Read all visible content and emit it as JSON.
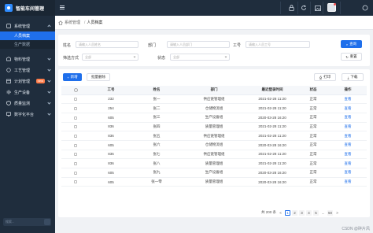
{
  "app": {
    "title": "智能车间管理"
  },
  "sidebar": {
    "items": [
      {
        "label": "系统管理",
        "icon": "system-icon",
        "expanded": true,
        "children": [
          {
            "label": "人员档案",
            "active": true
          },
          {
            "label": "生产数据",
            "active": false
          }
        ]
      },
      {
        "label": "物料管理",
        "icon": "material-icon"
      },
      {
        "label": "工艺管理",
        "icon": "process-icon"
      },
      {
        "label": "计划管理",
        "icon": "plan-icon",
        "badge": "new"
      },
      {
        "label": "生产设备",
        "icon": "equipment-icon"
      },
      {
        "label": "质量监测",
        "icon": "quality-icon"
      },
      {
        "label": "数字化平台",
        "icon": "digital-icon"
      }
    ],
    "search_placeholder": "搜索..."
  },
  "topbar": {
    "icons": [
      "menu-icon",
      "lock-icon",
      "refresh-icon",
      "image-icon",
      "bell-icon",
      "avatar"
    ]
  },
  "breadcrumb": {
    "items": [
      "系统管理",
      "人员档案"
    ]
  },
  "filters": {
    "name_label": "姓名",
    "name_placeholder": "请输入人员姓名",
    "dept_label": "部门",
    "dept_placeholder": "请输入人员部门",
    "id_label": "工号",
    "id_placeholder": "请输入人员工号",
    "sort_label": "筛选方式",
    "sort_value": "全部",
    "status_label": "状态",
    "status_value": "全部",
    "search_btn": "查询",
    "reset_btn": "重置"
  },
  "toolbar": {
    "add_btn": "新增",
    "batch_delete_btn": "批量删除",
    "print_btn": "打印",
    "download_btn": "下载"
  },
  "table": {
    "columns": [
      "工号",
      "姓名",
      "部门",
      "最近登录时间",
      "状态",
      "操作"
    ],
    "rows": [
      {
        "id": "232",
        "name": "张一",
        "dept": "供应链管理组",
        "time": "2021-02-28 11:20",
        "status": "正常",
        "op": "查看"
      },
      {
        "id": "254",
        "name": "张二",
        "dept": "仓储物流组",
        "time": "2021-02-28 11:20",
        "status": "正常",
        "op": "查看"
      },
      {
        "id": "605",
        "name": "张三",
        "dept": "生产设备组",
        "time": "2020-03-28 16:20",
        "status": "正常",
        "op": "查看"
      },
      {
        "id": "836",
        "name": "张四",
        "dept": "质量管理组",
        "time": "2021-02-28 11:20",
        "status": "正常",
        "op": "查看"
      },
      {
        "id": "836",
        "name": "张五",
        "dept": "供应链管理组",
        "time": "2021-02-28 11:20",
        "status": "正常",
        "op": "查看"
      },
      {
        "id": "605",
        "name": "张六",
        "dept": "仓储物流组",
        "time": "2020-03-28 16:20",
        "status": "正常",
        "op": "查看"
      },
      {
        "id": "836",
        "name": "张七",
        "dept": "供应链管理组",
        "time": "2021-02-28 11:20",
        "status": "正常",
        "op": "查看"
      },
      {
        "id": "836",
        "name": "张八",
        "dept": "质量管理组",
        "time": "2021-02-28 11:20",
        "status": "正常",
        "op": "查看"
      },
      {
        "id": "605",
        "name": "张九",
        "dept": "生产设备组",
        "time": "2020-03-28 16:20",
        "status": "正常",
        "op": "查看"
      },
      {
        "id": "605",
        "name": "张一零",
        "dept": "质量管理组",
        "time": "2020-03-28 16:20",
        "status": "正常",
        "op": "查看"
      }
    ]
  },
  "pagination": {
    "total_text": "共 200 条",
    "prev": "<",
    "pages": [
      "1",
      "2",
      "3",
      "4",
      "5",
      "...",
      "50"
    ],
    "current": "1",
    "next": ">"
  },
  "watermark": "CSDN @碎片风"
}
